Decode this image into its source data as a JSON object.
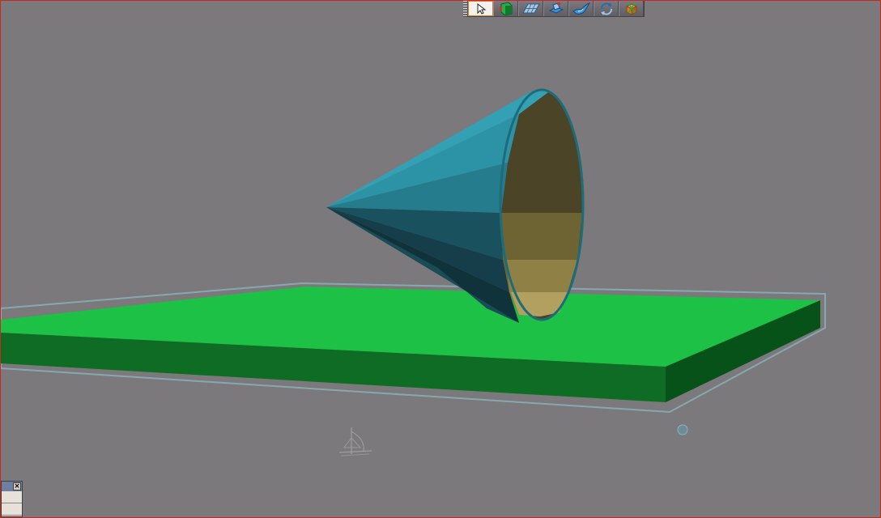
{
  "viewport": {
    "background": "#7b797c",
    "border_color": "#c62828"
  },
  "toolbar": {
    "tools": [
      {
        "name": "select-tool",
        "icon": "arrow-cursor-icon",
        "active": true
      },
      {
        "name": "shape-tool",
        "icon": "green-shape-icon",
        "active": false
      },
      {
        "name": "grid-tool",
        "icon": "grid-plane-icon",
        "active": false
      },
      {
        "name": "box-tool",
        "icon": "blue-box-icon",
        "active": false
      },
      {
        "name": "bird-tool",
        "icon": "bird-icon",
        "active": false
      },
      {
        "name": "rotate-tool",
        "icon": "rotate-arrows-icon",
        "active": false
      },
      {
        "name": "delete-tool",
        "icon": "delete-cube-icon",
        "active": false
      }
    ]
  },
  "scene": {
    "ground_color_top": "#1dc145",
    "ground_color_front": "#0d6a22",
    "ground_color_side": "#075419",
    "cone_color_outer": "#2b8ea0",
    "cone_color_inner": "#8a7a3c"
  },
  "mini_window": {
    "close_glyph": "×"
  }
}
